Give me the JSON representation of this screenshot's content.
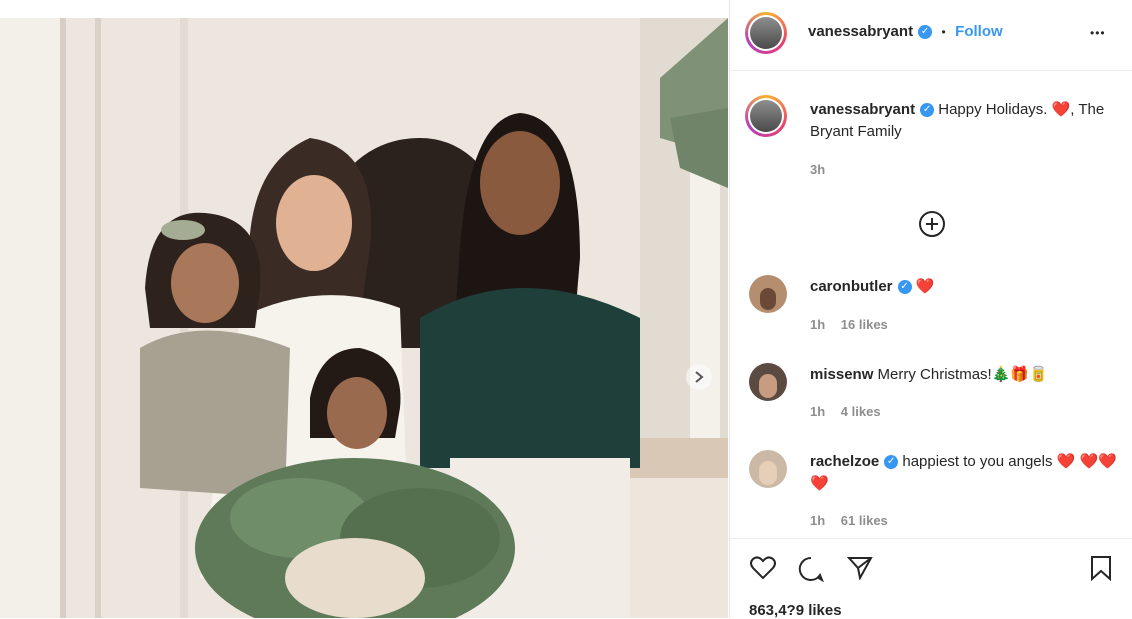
{
  "post": {
    "image_alt": "Family holiday photo of four smiling women and girls on a staircase with a wreath",
    "next_icon": "chevron-right-icon"
  },
  "header": {
    "username": "vanessabryant",
    "separator": "•",
    "follow_label": "Follow",
    "more_label": "•••"
  },
  "caption": {
    "username": "vanessabryant",
    "text": "Happy Holidays. ❤️, The Bryant Family",
    "time": "3h"
  },
  "load_more_icon": "plus-circle-icon",
  "comments": [
    {
      "username": "caronbutler",
      "verified": true,
      "text": "❤️",
      "time": "1h",
      "likes": "16 likes"
    },
    {
      "username": "missenw",
      "verified": false,
      "text": "Merry Christmas!🎄🎁🥫",
      "time": "1h",
      "likes": "4 likes"
    },
    {
      "username": "rachelzoe",
      "verified": true,
      "text": "happiest to you angels ❤️ ❤️❤️❤️",
      "time": "1h",
      "likes": "61 likes"
    }
  ],
  "actions": {
    "like_icon": "heart-icon",
    "comment_icon": "comment-icon",
    "share_icon": "send-icon",
    "save_icon": "bookmark-icon"
  },
  "likes_count": "863,4?9 likes",
  "colors": {
    "link": "#3897f0",
    "heart": "#ed4956",
    "text": "#262626",
    "muted": "#8e8e8e"
  }
}
